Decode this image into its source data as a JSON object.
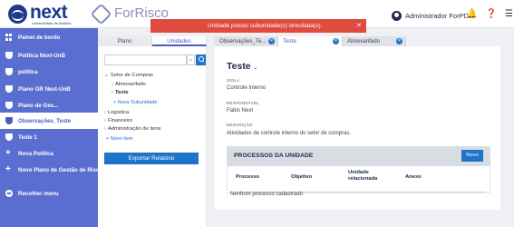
{
  "topbar": {
    "logo_text": "next",
    "logo_subtext": "Universidade de Brasília",
    "app_name": "ForRisco",
    "user_name": "Administrador ForPDI",
    "icons": [
      "user-avatar-icon",
      "bell-icon",
      "help-icon",
      "menu-icon"
    ]
  },
  "toast": {
    "message": "Unidade possui subunidade(s) vinculada(s).",
    "color": "#e04b3f"
  },
  "sidebar": {
    "items": [
      {
        "label": "Painel de bordo",
        "icon": "dashboard-icon"
      },
      {
        "label": "Política Next-UnB",
        "icon": "shield-icon"
      },
      {
        "label": "política",
        "icon": "shield-icon"
      },
      {
        "label": "Plano GR Next-UnB",
        "icon": "shield-icon"
      },
      {
        "label": "Plano de Ges...",
        "icon": "shield-icon"
      },
      {
        "label": "Observações_Teste",
        "icon": "shield-icon",
        "active": true
      },
      {
        "label": "Teste 1",
        "icon": "shield-icon"
      },
      {
        "label": "Nova Política",
        "icon": "plus-icon"
      },
      {
        "label": "Novo Plano de Gestão de Risco",
        "icon": "plus-icon"
      },
      {
        "label": "Recolher menu",
        "icon": "collapse-icon"
      }
    ],
    "color": "#5a6dd0"
  },
  "left_panel": {
    "tabs": [
      "Plano",
      "Unidades"
    ],
    "active_tab": "Unidades",
    "search_placeholder": "",
    "tree": {
      "setor_compras": "Setor de Compras",
      "almoxarifado": "Almoxarifado",
      "teste": "Teste",
      "nova_subunidade": "+ Nova Subunidade",
      "logistica": "Logística",
      "financeiro": "Financeiro",
      "admin_itens": "Administração de itens",
      "novo_item": "+ Novo item"
    },
    "export_label": "Exportar Relatório"
  },
  "right_tabs": [
    {
      "label": "Observações_Te...",
      "closable": true
    },
    {
      "label": "Teste",
      "closable": true,
      "active": true
    },
    {
      "label": "Almoxarifado",
      "closable": true
    }
  ],
  "unit": {
    "title": "Teste",
    "sigla_label": "SIGLA",
    "sigla_value": "Controle Interno",
    "responsavel_label": "RESPONSÁVEL",
    "responsavel_value": "Fabio Next",
    "descricao_label": "DESCRIÇÃO",
    "descricao_value": "Atividades de controle interno do setor de compras."
  },
  "processes": {
    "title": "PROCESSOS DA UNIDADE",
    "new_button": "Novo",
    "columns": [
      "Processo",
      "Objetivo",
      "Unidade relacionada",
      "Anexo"
    ],
    "empty_message": "Nenhum processo cadastrado"
  },
  "colors": {
    "primary": "#1d74c8",
    "accent": "#4a5cc0",
    "error": "#e04b3f"
  }
}
